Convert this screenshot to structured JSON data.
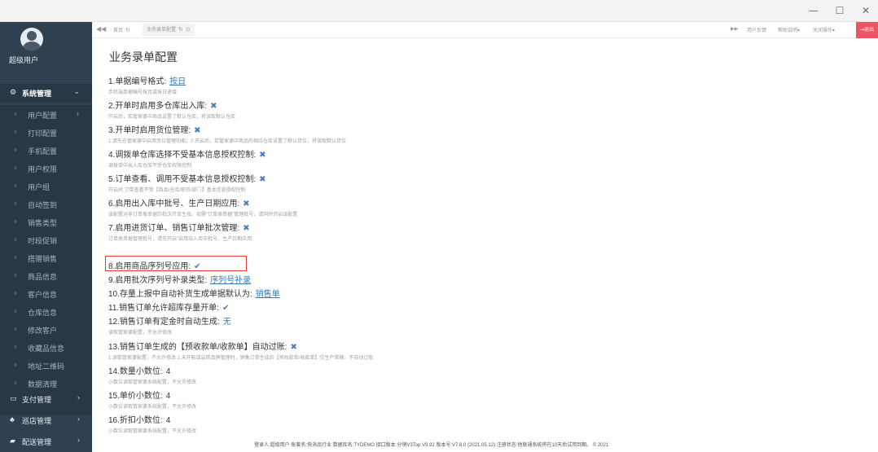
{
  "window": {
    "minimize_glyph": "—",
    "maximize_glyph": "☐",
    "close_glyph": "✕"
  },
  "sidebar": {
    "username": "超级用户",
    "groups": [
      {
        "label": "系统管理",
        "icon": "gear-icon",
        "glyph": "⚙",
        "arrow": "⌄"
      },
      {
        "label": "支付管理",
        "icon": "card-icon",
        "glyph": "▭",
        "arrow": "›"
      },
      {
        "label": "巡店管理",
        "icon": "sitemap-icon",
        "glyph": "♣",
        "arrow": "›"
      },
      {
        "label": "配送管理",
        "icon": "truck-icon",
        "glyph": "▰",
        "arrow": "›"
      }
    ],
    "items": [
      {
        "label": "用户配置",
        "arrow": "›"
      },
      {
        "label": "打印配置"
      },
      {
        "label": "手机配置"
      },
      {
        "label": "用户权限"
      },
      {
        "label": "用户组"
      },
      {
        "label": "自动签到"
      },
      {
        "label": "销售类型"
      },
      {
        "label": "时段促销"
      },
      {
        "label": "搭赠销售"
      },
      {
        "label": "商品信息"
      },
      {
        "label": "客户信息"
      },
      {
        "label": "仓库信息"
      },
      {
        "label": "修改客户"
      },
      {
        "label": "收藏品信息"
      },
      {
        "label": "地址二维码"
      },
      {
        "label": "数据清理"
      }
    ]
  },
  "tabbar": {
    "back_glyph": "◀◀",
    "home_tab": "首页",
    "active_tab": "业务录单配置",
    "refresh_glyph": "↻",
    "close_glyph": "⊙",
    "forward_glyph": "▶▶",
    "feedback": "用户反馈",
    "help": "帮助说明▾",
    "close_ops": "关闭操作▾",
    "logout": "退出"
  },
  "page": {
    "title": "业务录单配置",
    "settings": [
      {
        "title": "1.单据编号格式:",
        "value": "按日",
        "value_type": "link",
        "desc": "手机端单据编号按月或按日递增"
      },
      {
        "title": "2.开单时启用多仓库出入库:",
        "value": "✖",
        "value_type": "x",
        "desc": "开启后，若管家婆中商品设置了默认仓库，将读取默认仓库"
      },
      {
        "title": "3.开单时启用货位管理:",
        "value": "✖",
        "value_type": "x",
        "desc": "1.请先在管家婆中启用货位管理功能；2.开启后，若管家婆中商品的相应仓库设置了默认货位，将读取默认货位"
      },
      {
        "title": "4.调拨单仓库选择不受基本信息授权控制:",
        "value": "✖",
        "value_type": "x",
        "desc": "调拨单中出入库仓库不受仓库权限控制"
      },
      {
        "title": "5.订单查看、调用不受基本信息授权控制:",
        "value": "✖",
        "value_type": "x",
        "desc": "开启时,订单查看不受【商品/仓库/职员/部门】基本信息授权控制"
      },
      {
        "title": "6.启用出入库中批号、生产日期应用:",
        "value": "✖",
        "value_type": "x",
        "desc": "该配置对非订单类单据的批次开单生效。如需\"订单类单据\"管理批号，请同时开启该配置"
      },
      {
        "title": "7.启用进货订单、销售订单批次管理:",
        "value": "✖",
        "value_type": "x",
        "desc": "订单类单据管理批号，请先开启\"启用出入库中批号、生产日期应用"
      },
      {
        "title": "8.启用商品序列号应用:",
        "value": "✔",
        "value_type": "check",
        "desc": ""
      },
      {
        "title": "9.启用批次序列号补录类型:",
        "value": "序列号补录",
        "value_type": "link",
        "desc": ""
      },
      {
        "title": "10.存量上报中自动补货生成单据默认为:",
        "value": "销售单",
        "value_type": "link",
        "desc": ""
      },
      {
        "title": "11.销售订单允许超库存量开单:",
        "value": "✔",
        "value_type": "check",
        "desc": ""
      },
      {
        "title": "12.销售订单有定金时自动生成:",
        "value": "无",
        "value_type": "text",
        "desc": "读取管家婆配置，不允许修改"
      },
      {
        "title": "13.销售订单生成的【预收款单/收款单】自动过账:",
        "value": "✖",
        "value_type": "x",
        "desc": "1.读取管家婆配置，不允许修改 2.未开账或启用品牌管理时，销售订单生成的【预收款单/收款单】仅生产草稿，不自动过账"
      },
      {
        "title": "14.数量小数位:",
        "value": "4",
        "value_type": "num",
        "desc": "小数位读取管家婆系统配置，不允许修改"
      },
      {
        "title": "15.单价小数位:",
        "value": "4",
        "value_type": "num",
        "desc": "小数位读取管家婆系统配置，不允许修改"
      },
      {
        "title": "16.折扣小数位:",
        "value": "4",
        "value_type": "num",
        "desc": "小数位读取管家婆系统配置，不允许修改"
      }
    ]
  },
  "footer": {
    "text": "登录人:超级用户   账套名:快消品行业   数据库名:TYDEMO   接口版本:分销V3Top V9.92   版本号:V7.8.0 (2021.05.12)  注册状态:他联通系统将在10天后试用到期。   © 2021"
  },
  "colors": {
    "sidebar_bg": "#2f4050",
    "accent_blue": "#337ab7",
    "highlight_red": "#e53935",
    "logout_red": "#ed5565"
  }
}
